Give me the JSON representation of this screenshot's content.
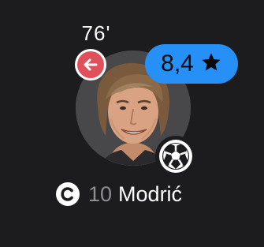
{
  "player": {
    "sub_time": "76'",
    "rating": "8,4",
    "shirt_number": "10",
    "name": "Modrić"
  },
  "icons": {
    "substitution": "sub-out-arrow-icon",
    "rating": "star-icon",
    "event": "football-goal-icon",
    "captain": "captain-c-icon"
  },
  "colors": {
    "background": "#1c1c1e",
    "rating_badge": "#2690f7",
    "sub_out": "#e0505a",
    "avatar_bg": "#48484a",
    "shirt_number": "#8e8e93"
  }
}
